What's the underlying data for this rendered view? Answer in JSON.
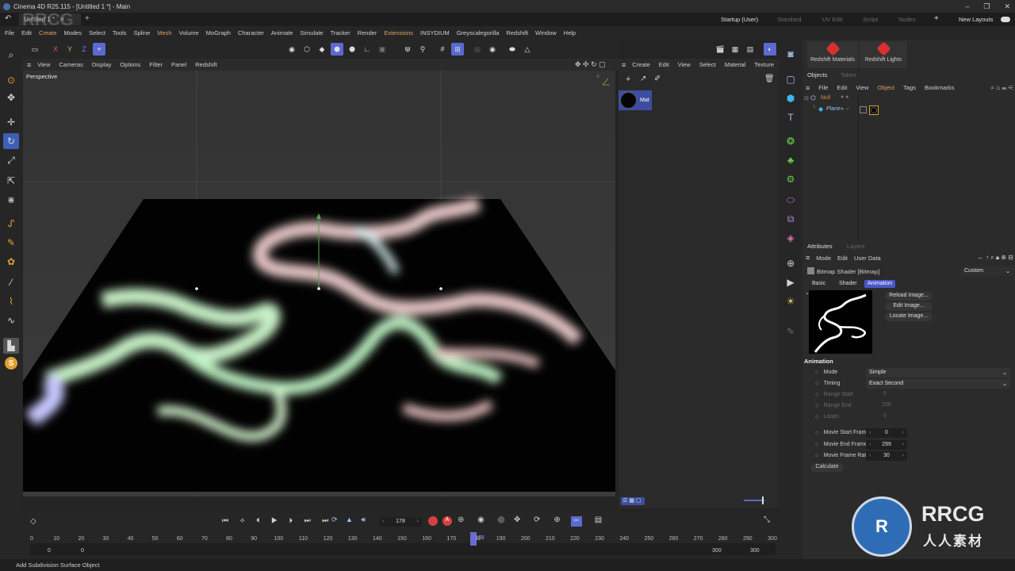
{
  "window": {
    "title": "Cinema 4D R25.115 - [Untitled 1 *] - Main",
    "controls": [
      "–",
      "❐",
      "✕"
    ]
  },
  "tabs": {
    "document_tab": "Untitled 1 *",
    "layouts": [
      "Startup (User)",
      "Standard",
      "UV Edit",
      "Script",
      "Nodes"
    ],
    "active_layout": "Startup (User)",
    "new_layouts": "New Layouts"
  },
  "menubar": [
    "File",
    "Edit",
    "Create",
    "Modes",
    "Select",
    "Tools",
    "Spline",
    "Mesh",
    "Volume",
    "MoGraph",
    "Character",
    "Animate",
    "Simulate",
    "Tracker",
    "Render",
    "Extensions",
    "INSYDIUM",
    "Greyscalegorilla",
    "Redshift",
    "Window",
    "Help"
  ],
  "axis_locks": [
    "X",
    "Y",
    "Z"
  ],
  "viewport": {
    "menu": [
      "View",
      "Cameras",
      "Display",
      "Options",
      "Filter",
      "Panel",
      "Redshift"
    ],
    "label": "Perspective"
  },
  "material_manager": {
    "menu": [
      "Create",
      "Edit",
      "View",
      "Select",
      "Material",
      "Texture"
    ],
    "material_name": "Mat"
  },
  "redshift_buttons": [
    "Redshift Materials",
    "Redshift Lights"
  ],
  "objects_panel": {
    "tabs": [
      "Objects",
      "Takes"
    ],
    "menu": [
      "File",
      "Edit",
      "View",
      "Object",
      "Tags",
      "Bookmarks"
    ],
    "items": [
      {
        "name": "Null",
        "color": "#e08a3a"
      },
      {
        "name": "Plane",
        "color": "#9ec3e6"
      }
    ]
  },
  "attributes": {
    "tabs": [
      "Attributes",
      "Layers"
    ],
    "menu": [
      "Mode",
      "Edit",
      "User Data"
    ],
    "title": "Bitmap Shader [Bitmap]",
    "mode_value": "Custom",
    "subtabs": [
      "Basic",
      "Shader",
      "Animation"
    ],
    "active_subtab": "Animation",
    "image_buttons": [
      "Reload Image...",
      "Edit Image...",
      "Locate Image..."
    ],
    "section": "Animation",
    "fields": [
      {
        "label": "Mode",
        "value": "Simple",
        "enabled": true
      },
      {
        "label": "Timing",
        "value": "Exact Second",
        "enabled": true
      },
      {
        "label": "Range Start",
        "value": "0",
        "enabled": false
      },
      {
        "label": "Range End",
        "value": "150",
        "enabled": false
      },
      {
        "label": "Loops",
        "value": "0",
        "enabled": false
      },
      {
        "label": "Movie Start Frame",
        "value": "0",
        "enabled": true
      },
      {
        "label": "Movie End Frame",
        "value": "299",
        "enabled": true
      },
      {
        "label": "Movie Frame Rate",
        "value": "30",
        "enabled": true
      }
    ],
    "calculate": "Calculate"
  },
  "timeline": {
    "current_frame": "178",
    "playhead_label": "178",
    "ticks": [
      "0",
      "10",
      "20",
      "30",
      "40",
      "50",
      "60",
      "70",
      "80",
      "90",
      "100",
      "110",
      "120",
      "130",
      "140",
      "150",
      "160",
      "170",
      "180",
      "190",
      "200",
      "210",
      "220",
      "230",
      "240",
      "250",
      "260",
      "270",
      "280",
      "290",
      "300"
    ],
    "start": "0",
    "start2": "0",
    "end": "300",
    "end2": "300"
  },
  "status": "Add Subdivision Surface Object",
  "watermark": {
    "top": "RRCG",
    "brand": "RRCG",
    "sub": "人人素材"
  },
  "colors": {
    "accent": "#5a6ad0",
    "selected_tab": "#4a57c8",
    "record": "#d84040",
    "bg": "#242424"
  }
}
